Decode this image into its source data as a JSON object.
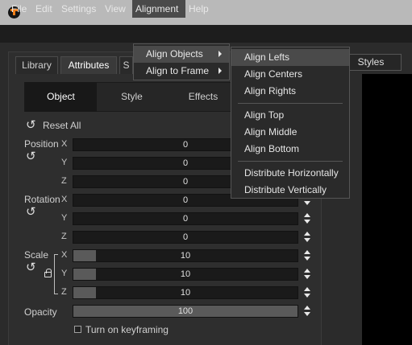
{
  "menubar": {
    "items": [
      "File",
      "Edit",
      "Settings",
      "View",
      "Alignment",
      "Help"
    ]
  },
  "tabs": {
    "library": "Library",
    "attributes": "Attributes",
    "partial": "S",
    "styles": "Styles"
  },
  "subtabs": [
    "Object",
    "Style",
    "Effects"
  ],
  "attributes": {
    "reset_all": "Reset All",
    "position_label": "Position",
    "rotation_label": "Rotation",
    "scale_label": "Scale",
    "opacity_label": "Opacity",
    "position": {
      "x": "0",
      "y": "0",
      "z": "0"
    },
    "rotation": {
      "x": "0",
      "y": "0",
      "z": "0"
    },
    "scale": {
      "x": "10",
      "y": "10",
      "z": "10",
      "fill_fraction": 0.1
    },
    "opacity": {
      "value": "100",
      "fill_fraction": 1.0
    },
    "axis_x": "X",
    "axis_y": "Y",
    "axis_z": "Z",
    "keyframing": "Turn on keyframing"
  },
  "alignment_menu": {
    "items": [
      "Align Objects",
      "Align to Frame"
    ],
    "submenu": [
      "Align Lefts",
      "Align Centers",
      "Align Rights",
      "Align Top",
      "Align Middle",
      "Align Bottom",
      "Distribute Horizontally",
      "Distribute Vertically"
    ]
  },
  "colors": {
    "brand_accent": "#f07f1a",
    "menu_highlight": "#4a4a4a",
    "preview_background": "#000000"
  },
  "icons": {
    "app": "app-logo-icon",
    "reset": "reset-icon",
    "lock": "lock-icon",
    "submenu_arrow": "chevron-right-icon"
  }
}
